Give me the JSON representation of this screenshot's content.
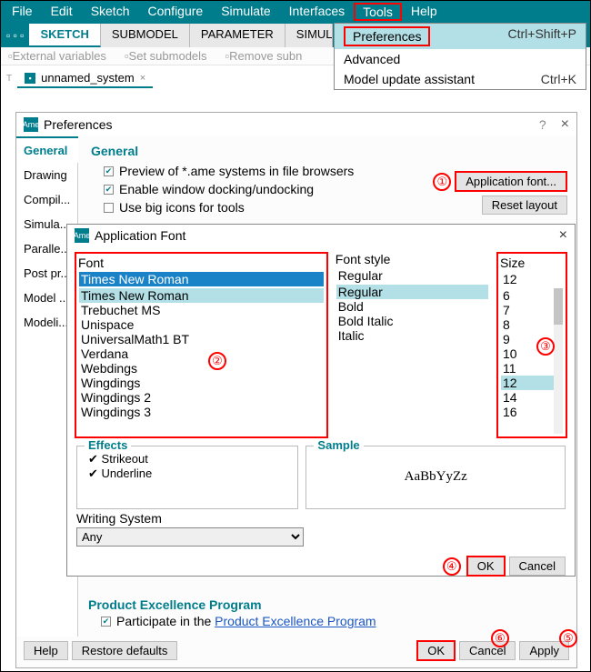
{
  "menubar": {
    "items": [
      "File",
      "Edit",
      "Sketch",
      "Configure",
      "Simulate",
      "Interfaces",
      "Tools",
      "Help"
    ]
  },
  "tabs": [
    "SKETCH",
    "SUBMODEL",
    "PARAMETER",
    "SIMUL"
  ],
  "dropdown": {
    "rows": [
      {
        "label": "Preferences",
        "shortcut": "Ctrl+Shift+P"
      },
      {
        "label": "Advanced",
        "shortcut": ""
      },
      {
        "label": "Model update assistant",
        "shortcut": "Ctrl+K"
      }
    ]
  },
  "second_row": [
    "External variables",
    "Set submodels",
    "Remove subn"
  ],
  "system_tab": {
    "name": "unnamed_system"
  },
  "prefs": {
    "title": "Preferences",
    "sidebar": [
      "General",
      "Drawing",
      "Compil...",
      "Simula...",
      "Paralle...",
      "Post pr...",
      "Model ...",
      "Modeli..."
    ],
    "section_title": "General",
    "checks": [
      {
        "label": "Preview of *.ame systems in file browsers",
        "checked": true
      },
      {
        "label": "Enable window docking/undocking",
        "checked": true
      },
      {
        "label": "Use big icons for tools",
        "checked": false
      }
    ],
    "btn_app_font": "Application font...",
    "btn_reset_layout": "Reset layout",
    "pep_title": "Product Excellence Program",
    "pep_row_prefix": "Participate in the ",
    "pep_link": "Product Excellence Program",
    "footer": {
      "help": "Help",
      "restore": "Restore defaults",
      "ok": "OK",
      "cancel": "Cancel",
      "apply": "Apply"
    }
  },
  "font_dialog": {
    "title": "Application Font",
    "font_label": "Font",
    "font_value": "Times New Roman",
    "font_list": [
      "Times New Roman",
      "Trebuchet MS",
      "Unispace",
      "UniversalMath1 BT",
      "Verdana",
      "Webdings",
      "Wingdings",
      "Wingdings 2",
      "Wingdings 3"
    ],
    "style_label": "Font style",
    "style_value": "Regular",
    "style_list": [
      "Regular",
      "Bold",
      "Bold Italic",
      "Italic"
    ],
    "size_label": "Size",
    "size_value": "12",
    "size_list": [
      "6",
      "7",
      "8",
      "9",
      "10",
      "11",
      "12",
      "14",
      "16"
    ],
    "effects_title": "Effects",
    "effects": [
      "Strikeout",
      "Underline"
    ],
    "sample_title": "Sample",
    "sample_text": "AaBbYyZz",
    "writing_label": "Writing System",
    "writing_value": "Any",
    "ok": "OK",
    "cancel": "Cancel"
  }
}
